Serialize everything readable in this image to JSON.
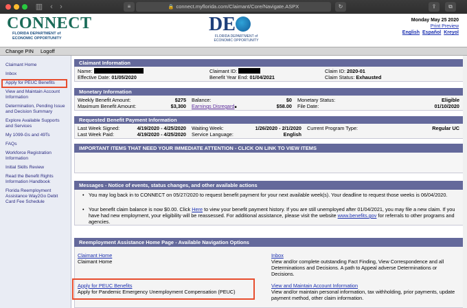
{
  "browser": {
    "url": "connect.myflorida.com/Claimant/Core/Navigate.ASPX",
    "lock_icon": "lock-icon",
    "sidebar_toggle_icon": "sidebar-icon",
    "share_icon": "share-icon",
    "tabs_icon": "tabs-icon"
  },
  "header": {
    "logo_word": "CONNECT",
    "logo_sub": [
      "FLORIDA DEPARTMENT of",
      "ECONOMIC OPPORTUNITY"
    ],
    "deo_word_a": "DE",
    "deo_sub": [
      "FLORIDA DEPARTMENT of",
      "ECONOMIC OPPORTUNITY"
    ],
    "date": "Monday May 25 2020",
    "print_preview": "Print Preview",
    "lang_english": "English",
    "lang_espanol": "Español",
    "lang_kreyol": "Kreyol"
  },
  "topnav": {
    "change_pin": "Change PIN",
    "logoff": "Logoff"
  },
  "sidebar": {
    "items": [
      "Claimant Home",
      "Inbox",
      "Apply for PEUC Benefits",
      "View and Maintain Account Information",
      "Determination, Pending Issue and Decision Summary",
      "Explore Available Supports and Services",
      "My 1099-Gs and 49Ts",
      "FAQs",
      "Workforce Registration Information",
      "Initial Skills Review",
      "Read the Benefit Rights Information Handbook",
      "Florida Reemployment Assistance Way2Go Debit Card Fee Schedule"
    ]
  },
  "claimant": {
    "title": "Claimant Information",
    "name_label": "Name:",
    "claimant_id_label": "Claimant ID:",
    "claim_id_label": "Claim ID:",
    "claim_id_value": "2020-01",
    "effective_label": "Effective Date:",
    "effective_value": "01/05/2020",
    "bye_label": "Benefit Year End:",
    "bye_value": "01/04/2021",
    "status_label": "Claim Status:",
    "status_value": "Exhausted"
  },
  "monetary": {
    "title": "Monetary Information",
    "weekly_label": "Weekly Benefit Amount:",
    "weekly_value": "$275",
    "max_label": "Maximum Benefit Amount:",
    "max_value": "$3,300",
    "balance_label": "Balance:",
    "balance_value": "$0",
    "earnings_label": "Earnings Disregard",
    "earnings_value": "$58.00",
    "mstatus_label": "Monetary Status:",
    "mstatus_value": "Eligible",
    "file_label": "File Date:",
    "file_value": "01/10/2020"
  },
  "requested": {
    "title": "Requested Benefit Payment Information",
    "signed_label": "Last Week Signed:",
    "signed_value": "4/19/2020 - 4/25/2020",
    "paid_label": "Last Week Paid:",
    "paid_value": "4/19/2020 - 4/25/2020",
    "waiting_label": "Waiting Week:",
    "waiting_value": "1/26/2020 - 2/1/2020",
    "lang_label": "Service Language:",
    "lang_value": "English",
    "program_label": "Current Program Type:",
    "program_value": "Regular UC"
  },
  "important": {
    "title": "IMPORTANT ITEMS THAT NEED YOUR IMMEDIATE ATTENTION - CLICK ON LINK TO VIEW ITEMS"
  },
  "messages": {
    "title": "Messages - Notice of events, status changes, and other available actions",
    "m1": "You may log back in to CONNECT on 05/27/2020 to request benefit payment for your next available week(s). Your deadline to request those weeks is 06/04/2020.",
    "m2_a": "Your benefit claim balance is now $0.00. Click ",
    "m2_link": "Here",
    "m2_b": " to view your benefit payment history. If you are still unemployed after 01/04/2021, you may file a new claim. If you have had new employment, your eligibility will be reassessed. For additional assistance, please visit the website ",
    "m2_site": "www.benefits.gov",
    "m2_c": " for referrals to other programs and agencies."
  },
  "navpage": {
    "title": "Reemployment Assistance Home Page - Available Navigation Options",
    "home_link": "Claimant Home",
    "home_desc": "Claimant Home",
    "inbox_link": "Inbox",
    "inbox_desc": "View and/or complete outstanding Fact Finding, View Correspondence and all Determinations and Decisions. A path to Appeal adverse Determinations or Decisions.",
    "peuc_link": "Apply for PEUC Benefits",
    "peuc_desc": "Apply for Pandemic Emergency Unemployment Compensation (PEUC)",
    "acct_link": "View and Maintain Account Information",
    "acct_desc": "View and/or maintain personal information, tax withholding, prior payments, update payment method, other claim information."
  }
}
